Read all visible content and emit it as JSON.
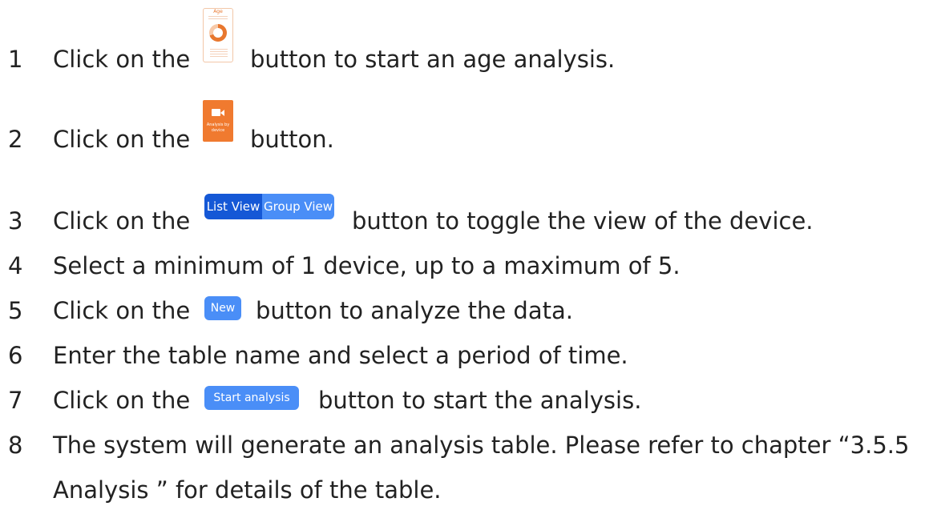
{
  "steps": [
    {
      "number": "1",
      "before": "Click on the",
      "after": "button to start an age analysis."
    },
    {
      "number": "2",
      "before": "Click on the",
      "after": "button."
    },
    {
      "number": "3",
      "before": "Click on the",
      "after": "button to toggle the view of the device."
    },
    {
      "number": "4",
      "text": "Select a minimum of 1 device, up to a maximum of 5."
    },
    {
      "number": "5",
      "before": "Click on the",
      "after": "button to analyze the data."
    },
    {
      "number": "6",
      "text": "Enter the table name and select a period of time."
    },
    {
      "number": "7",
      "before": "Click on the",
      "after": "button to start the analysis."
    },
    {
      "number": "8",
      "line1": "The system will generate an analysis table. Please refer to chapter “3.5.5",
      "line2": "Analysis ” for details of the table."
    }
  ],
  "buttons": {
    "age": {
      "title": "Age",
      "center": "50"
    },
    "device": {
      "label": "Analysis by device"
    },
    "list_view": "List View",
    "group_view": "Group View",
    "new": "New",
    "start_analysis": "Start analysis"
  },
  "colors": {
    "orange": "#f07a2f",
    "blue_dark": "#1558d6",
    "blue": "#4a8ef7"
  }
}
